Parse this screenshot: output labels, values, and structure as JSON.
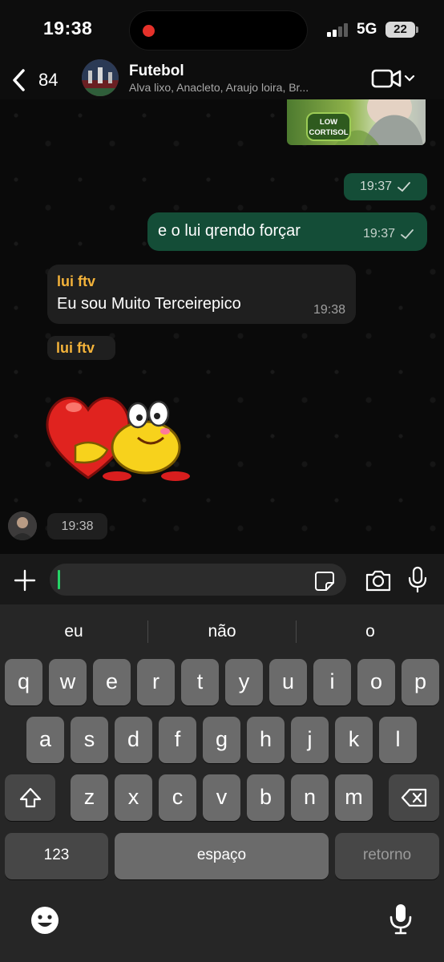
{
  "status_bar": {
    "time": "19:38",
    "network": "5G",
    "battery": "22",
    "recording_color": "#e5312a"
  },
  "header": {
    "back_count": "84",
    "title": "Futebol",
    "subtitle": "Alva lixo, Anacleto, Araujo loira, Br..."
  },
  "chat": {
    "image_badge_text": "LOW CORTISOL",
    "time_only_outgoing": "19:37",
    "outgoing_message": {
      "text": "e o lui qrendo forçar",
      "time": "19:37"
    },
    "incoming_message": {
      "sender": "lui ftv",
      "text": "Eu sou Muito Terceirepico",
      "time": "19:38"
    },
    "sticker_sender": "lui ftv",
    "sticker_time": "19:38",
    "colors": {
      "outgoing_bubble": "#144d37",
      "incoming_bubble": "#1f1f1f",
      "sender_name": "#f4b33a"
    }
  },
  "input": {
    "value": "",
    "placeholder": ""
  },
  "keyboard": {
    "suggestions": [
      "eu",
      "não",
      "o"
    ],
    "row1": [
      "q",
      "w",
      "e",
      "r",
      "t",
      "y",
      "u",
      "i",
      "o",
      "p"
    ],
    "row2": [
      "a",
      "s",
      "d",
      "f",
      "g",
      "h",
      "j",
      "k",
      "l"
    ],
    "row3": [
      "z",
      "x",
      "c",
      "v",
      "b",
      "n",
      "m"
    ],
    "numbers_label": "123",
    "space_label": "espaço",
    "return_label": "retorno"
  }
}
